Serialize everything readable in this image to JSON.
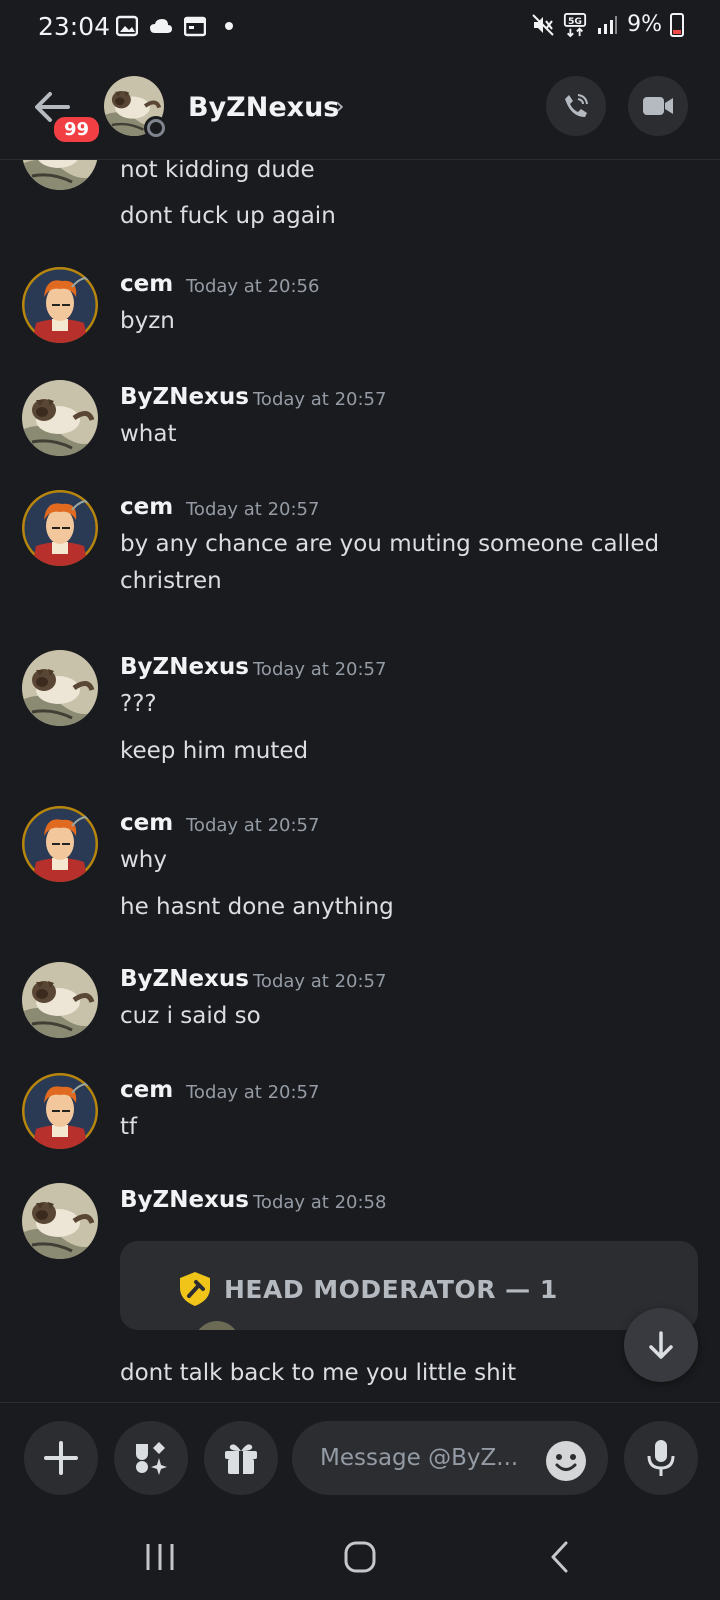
{
  "status_bar": {
    "time": "23:04",
    "network": "5G",
    "battery_percent": "9%",
    "icons": [
      "gallery-icon",
      "cloud-icon",
      "calendar-icon",
      "dot-icon",
      "mute-icon",
      "network-5g-icon",
      "signal-icon",
      "battery-icon"
    ]
  },
  "header": {
    "back_icon": "arrow-left-icon",
    "unread_badge": "99",
    "contact_name": "ByZNexus",
    "chevron": "›",
    "call_icon": "phone-call-icon",
    "video_icon": "video-camera-icon"
  },
  "messages": [
    {
      "author": "",
      "time": "",
      "lines": [
        "not kidding dude",
        "dont fuck up again"
      ],
      "avatar": "cat"
    },
    {
      "author": "cem",
      "time": "Today at 20:56",
      "lines": [
        "byzn"
      ],
      "avatar": "fry"
    },
    {
      "author": "ByZNexus",
      "time": "Today at 20:57",
      "lines": [
        "what"
      ],
      "avatar": "cat"
    },
    {
      "author": "cem",
      "time": "Today at 20:57",
      "lines": [
        "by any chance are you muting someone called christren"
      ],
      "avatar": "fry"
    },
    {
      "author": "ByZNexus",
      "time": "Today at 20:57",
      "lines": [
        "???",
        "keep him muted"
      ],
      "avatar": "cat"
    },
    {
      "author": "cem",
      "time": "Today at 20:57",
      "lines": [
        "why",
        "he hasnt done anything"
      ],
      "avatar": "fry"
    },
    {
      "author": "ByZNexus",
      "time": "Today at 20:57",
      "lines": [
        "cuz i said so"
      ],
      "avatar": "cat"
    },
    {
      "author": "cem",
      "time": "Today at 20:57",
      "lines": [
        "tf"
      ],
      "avatar": "fry"
    },
    {
      "author": "ByZNexus",
      "time": "Today at 20:58",
      "lines": [
        "dont talk back to me you little shit"
      ],
      "avatar": "cat"
    }
  ],
  "embed": {
    "title": "HEAD MODERATOR — 1",
    "icon": "shield-hammer-icon"
  },
  "input": {
    "placeholder": "Message @ByZ...",
    "add_icon": "plus-icon",
    "apps_icon": "apps-icon",
    "gift_icon": "gift-icon",
    "emoji_icon": "emoji-icon",
    "mic_icon": "microphone-icon"
  },
  "jump_icon": "arrow-down-icon",
  "navbar": {
    "recents_icon": "recents-icon",
    "home_icon": "home-icon",
    "back_icon": "back-chevron-icon"
  },
  "colors": {
    "background": "#1a1b1e",
    "surface": "#2b2d31",
    "badge": "#f23f43",
    "muted_text": "#949ba4"
  }
}
